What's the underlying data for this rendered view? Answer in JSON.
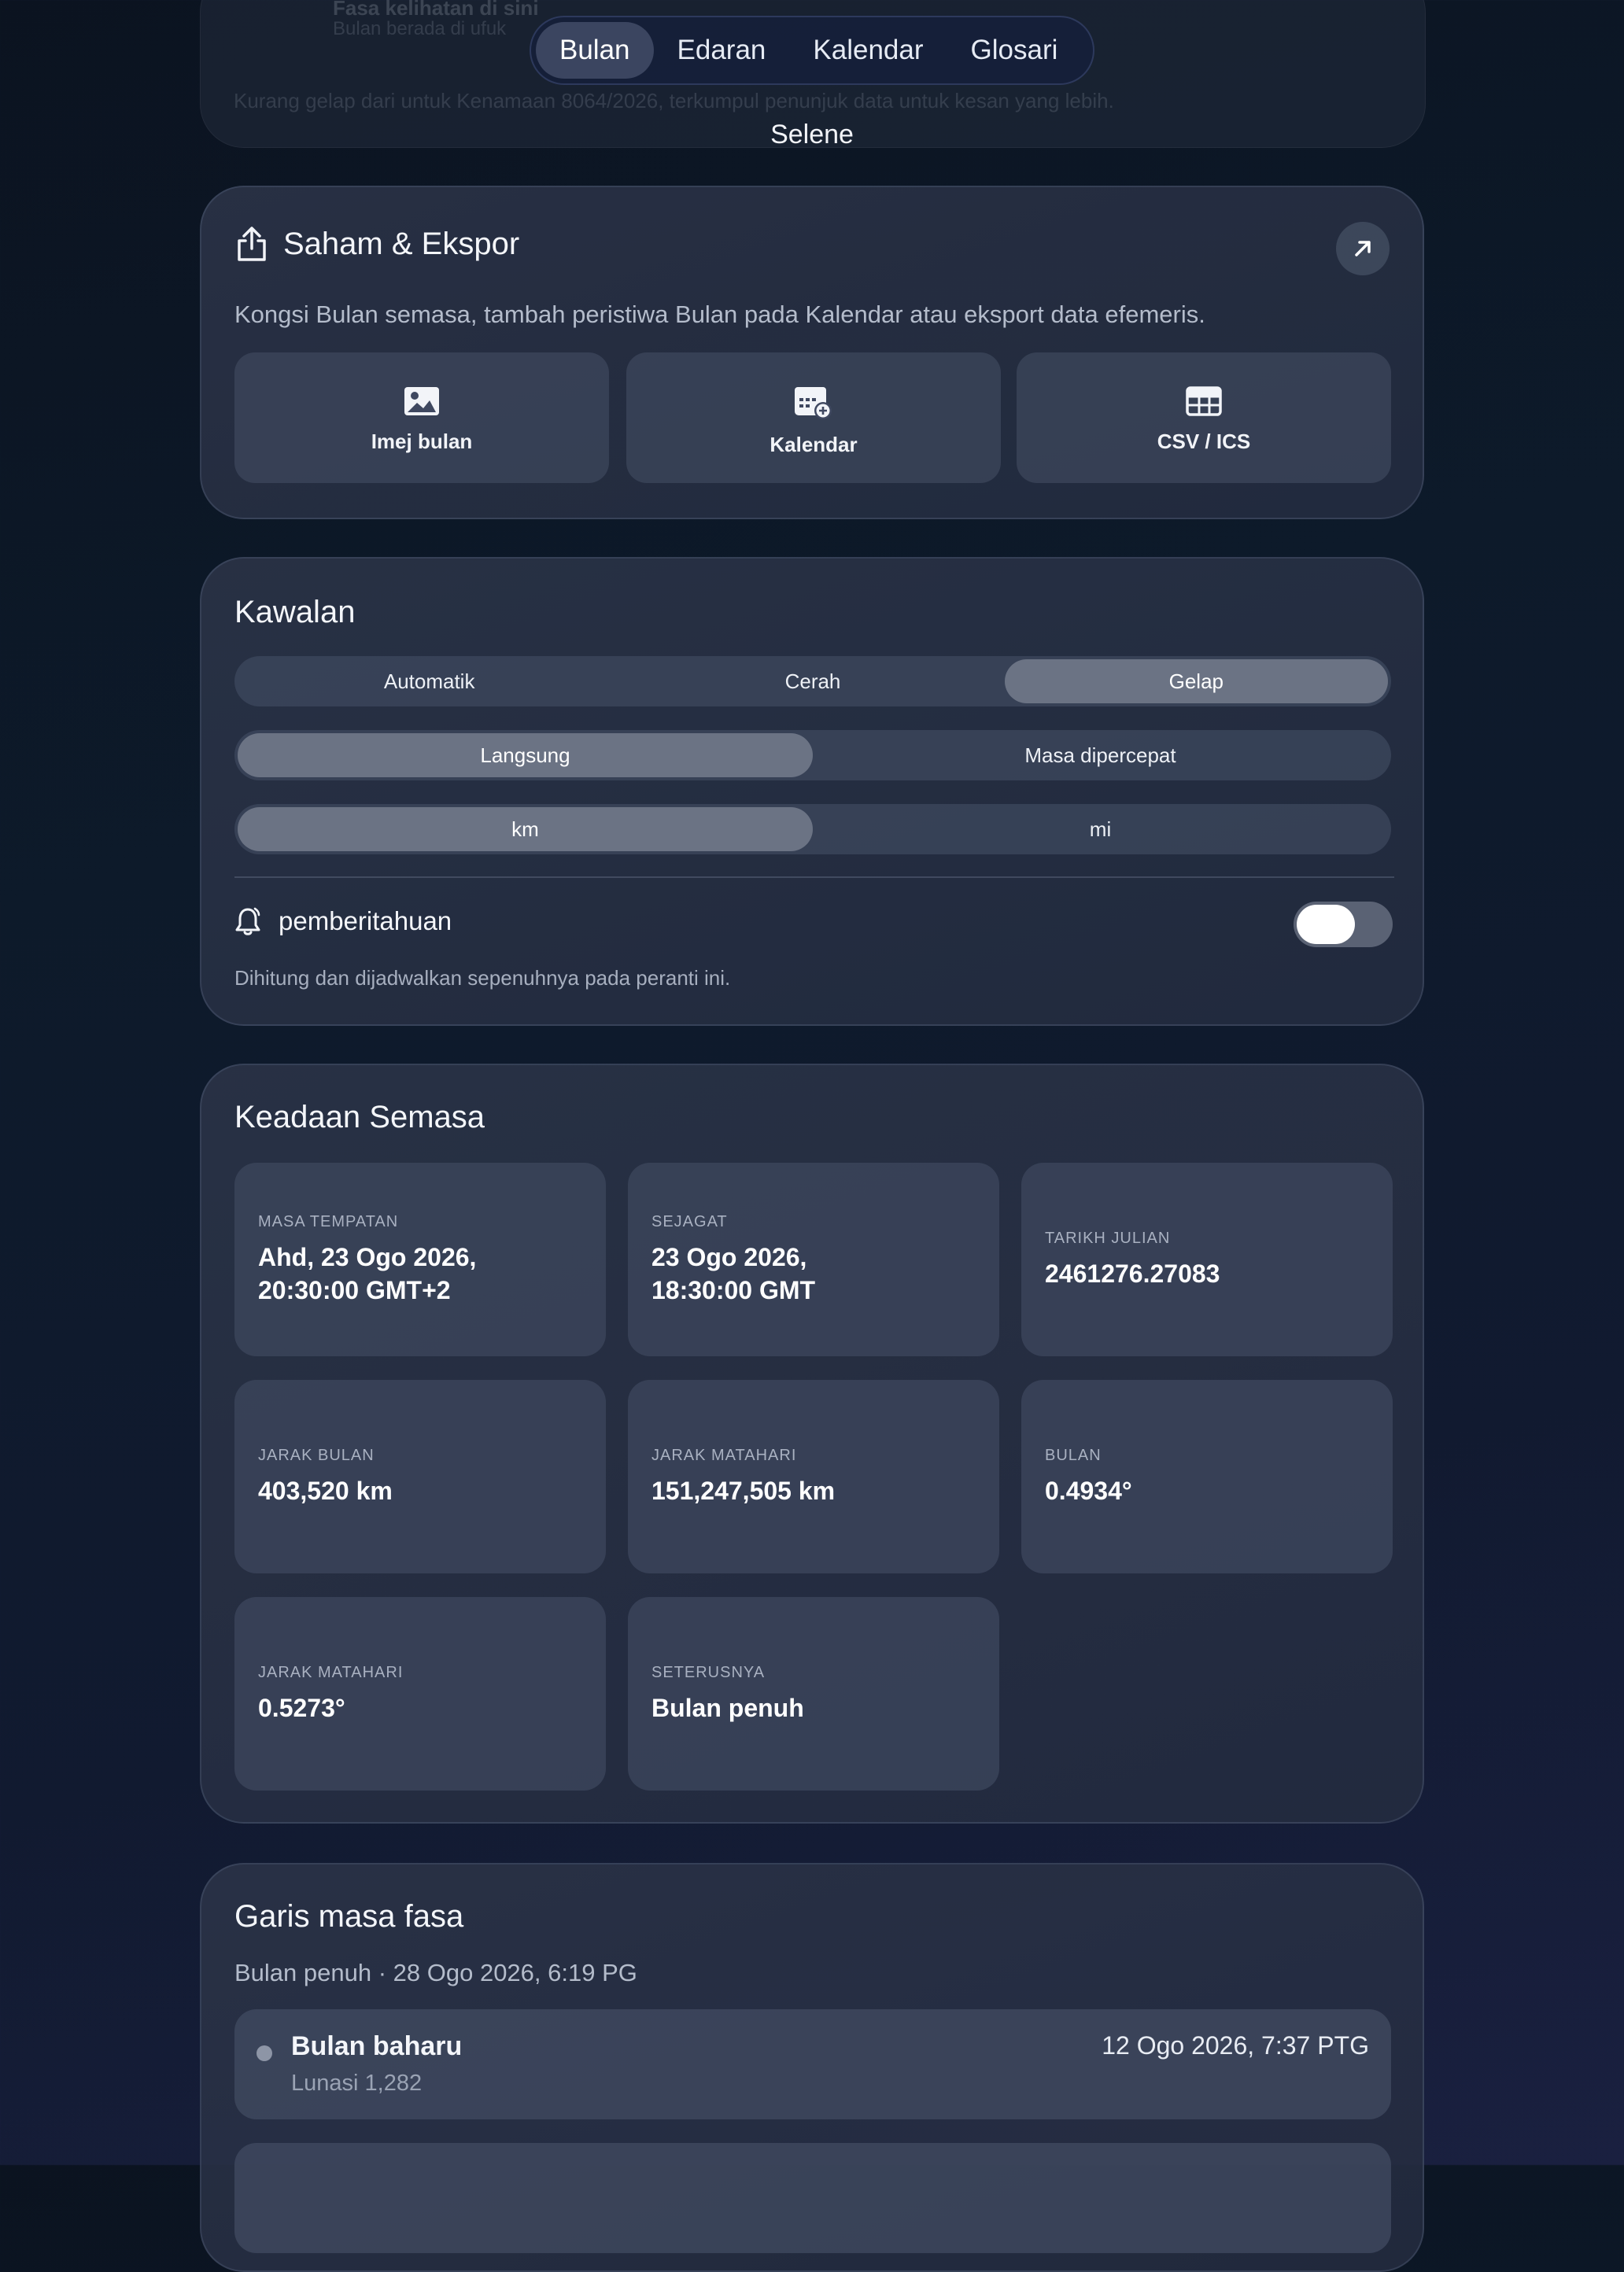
{
  "ghost": {
    "title": "Fasa kelihatan di sini",
    "subtitle": "Bulan berada di ufuk",
    "text": "Kurang gelap dari untuk Kenamaan 8064/2026, terkumpul penunjuk data untuk kesan yang lebih."
  },
  "nav": {
    "tabs": [
      "Bulan",
      "Edaran",
      "Kalendar",
      "Glosari"
    ],
    "active_index": 0
  },
  "app_title": "Selene",
  "share": {
    "title": "Saham & Ekspor",
    "description": "Kongsi Bulan semasa, tambah peristiwa Bulan pada Kalendar atau eksport data efemeris.",
    "tiles": [
      {
        "label": "Imej bulan",
        "icon": "image-icon"
      },
      {
        "label": "Kalendar",
        "icon": "calendar-add-icon"
      },
      {
        "label": "CSV / ICS",
        "icon": "table-icon"
      }
    ]
  },
  "controls": {
    "title": "Kawalan",
    "theme": {
      "options": [
        "Automatik",
        "Cerah",
        "Gelap"
      ],
      "selected": "Gelap"
    },
    "time_mode": {
      "options": [
        "Langsung",
        "Masa dipercepat"
      ],
      "selected": "Langsung"
    },
    "units": {
      "options": [
        "km",
        "mi"
      ],
      "selected": "km"
    },
    "notifications": {
      "label": "pemberitahuan",
      "enabled": false
    },
    "note": "Dihitung dan dijadwalkan sepenuhnya pada peranti ini."
  },
  "state": {
    "title": "Keadaan Semasa",
    "tiles": [
      {
        "key": "MASA TEMPATAN",
        "value": "Ahd, 23 Ogo 2026,\n20:30:00 GMT+2"
      },
      {
        "key": "SEJAGAT",
        "value": "23 Ogo 2026,\n18:30:00 GMT"
      },
      {
        "key": "TARIKH JULIAN",
        "value": "2461276.27083"
      },
      {
        "key": "JARAK BULAN",
        "value": "403,520 km"
      },
      {
        "key": "JARAK MATAHARI",
        "value": "151,247,505 km"
      },
      {
        "key": "BULAN",
        "value": "0.4934°"
      },
      {
        "key": "JARAK MATAHARI",
        "value": "0.5273°"
      },
      {
        "key": "SETERUSNYA",
        "value": "Bulan penuh"
      }
    ]
  },
  "timeline": {
    "title": "Garis masa fasa",
    "subtitle": "Bulan penuh · 28 Ogo 2026, 6:19 PG",
    "items": [
      {
        "name": "Bulan baharu",
        "lunation": "Lunasi 1,282",
        "date": "12 Ogo 2026, 7:37 PTG"
      }
    ]
  }
}
